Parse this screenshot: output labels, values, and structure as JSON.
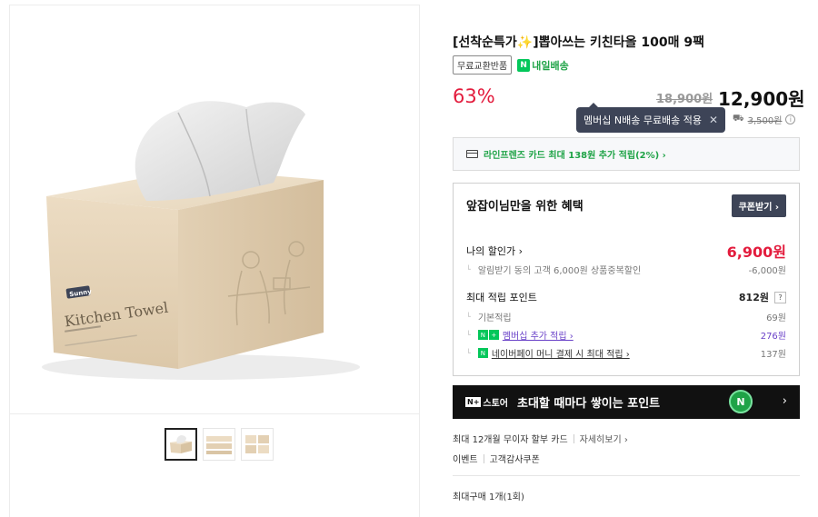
{
  "product": {
    "title": "[선착순특가✨]뽑아쓰는 키친타올 100매 9팩",
    "tag_free_exchange": "무료교환반품",
    "tag_next_day": "내일배송",
    "discount_rate": "63%",
    "original_price": "18,900원",
    "sale_price": "12,900원",
    "image_brand": "Sunny",
    "image_product_name": "Kitchen Towel"
  },
  "tooltip": {
    "text": "멤버십 N배송 무료배송 적용",
    "close_label": "✕"
  },
  "shipping": {
    "fee": "3,500원",
    "info_icon": "ⓘ"
  },
  "card_promo": {
    "text": "라인프렌즈 카드 최대 138원 추가 적립(2%) ›"
  },
  "benefit": {
    "title": "앞잡이님만을 위한 혜택",
    "coupon_button": "쿠폰받기 ›",
    "my_discount_label": "나의 할인가 ›",
    "my_discount_value": "6,900원",
    "alert_label": "알림받기 동의 고객 6,000원 상품중복할인",
    "alert_value": "-6,000원",
    "points_label": "최대 적립 포인트",
    "points_value": "812원",
    "points_help": "?",
    "basic_label": "기본적립",
    "basic_value": "69원",
    "membership_label": "멤버십 추가 적립 ›",
    "membership_value": "276원",
    "npay_label": "네이버페이 머니 결제 시 최대 적립 ›",
    "npay_value": "137원"
  },
  "banner": {
    "brand_badge": "N+",
    "brand_text": "스토어",
    "text": "초대할 때마다 쌓이는 포인트",
    "arrow": "›"
  },
  "installment": {
    "text": "최대 12개월 무이자 할부 카드",
    "more": "자세히보기 ›"
  },
  "events": {
    "event": "이벤트",
    "coupon": "고객감사쿠폰"
  },
  "max_purchase": "최대구매 1개(1회)"
}
